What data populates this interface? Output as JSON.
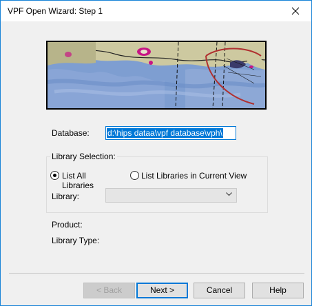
{
  "window": {
    "title": "VPF Open Wizard: Step 1"
  },
  "form": {
    "database_label": "Database:",
    "database_value": "d:\\hips dataa\\vpf database\\vph\\",
    "library_selection_label": "Library Selection:",
    "radio_all": "List All Libraries",
    "radio_current": "List Libraries in Current View",
    "library_label": "Library:",
    "library_value": "",
    "product_label": "Product:",
    "library_type_label": "Library Type:"
  },
  "buttons": {
    "back": "< Back",
    "next": "Next >",
    "cancel": "Cancel",
    "help": "Help"
  },
  "colors": {
    "accent": "#0078d7"
  }
}
